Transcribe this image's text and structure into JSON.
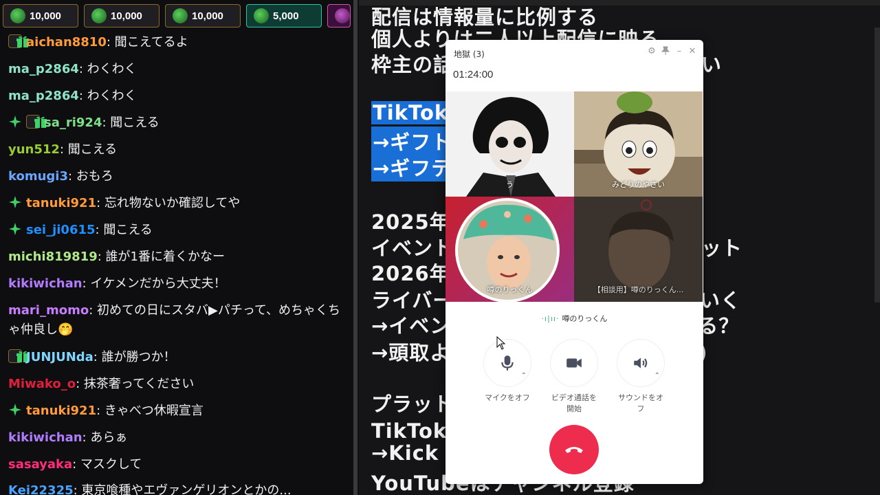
{
  "gifts": [
    {
      "amount": "10,000"
    },
    {
      "amount": "10,000"
    },
    {
      "amount": "10,000"
    },
    {
      "amount": "5,000"
    },
    {
      "amount": ""
    }
  ],
  "chat": [
    {
      "user": "aichan8810",
      "text": ": 聞こえてるよ",
      "color": "#ff9b3b",
      "badges": [
        "gift"
      ]
    },
    {
      "user": "ma_p2864",
      "text": ": わくわく",
      "color": "#8ee3c6",
      "badges": []
    },
    {
      "user": "ma_p2864",
      "text": ": わくわく",
      "color": "#8ee3c6",
      "badges": []
    },
    {
      "user": "sa_ri924",
      "text": ": 聞こえる",
      "color": "#7fe08a",
      "badges": [
        "sparkle",
        "gift"
      ]
    },
    {
      "user": "yun512",
      "text": ": 聞こえる",
      "color": "#9acd32",
      "badges": []
    },
    {
      "user": "komugi3",
      "text": ": おもろ",
      "color": "#6aa6ff",
      "badges": []
    },
    {
      "user": "tanuki921",
      "text": ": 忘れ物ないか確認してや",
      "color": "#ff9b3b",
      "badges": [
        "sparkle"
      ]
    },
    {
      "user": "sei_ji0615",
      "text": ": 聞こえる",
      "color": "#1e90ff",
      "badges": [
        "sparkle"
      ]
    },
    {
      "user": "michi819819",
      "text": ": 誰が1番に着くかなー",
      "color": "#b0e98a",
      "badges": []
    },
    {
      "user": "kikiwichan",
      "text": ": イケメンだから大丈夫！",
      "color": "#b27cff",
      "badges": []
    },
    {
      "user": "mari_momo",
      "text": ": 初めての日にスタバ▶パチって、めちゃくちゃ仲良し🤭",
      "color": "#c77dff",
      "badges": []
    },
    {
      "user": "JUNJUNda",
      "text": ": 誰が勝つか！",
      "color": "#7fd6ff",
      "badges": [
        "gift"
      ]
    },
    {
      "user": "Miwako_o",
      "text": ": 抹茶奢ってください",
      "color": "#e0203a",
      "badges": []
    },
    {
      "user": "tanuki921",
      "text": ": きゃべつ休暇宣言",
      "color": "#ff9b3b",
      "badges": [
        "sparkle"
      ]
    },
    {
      "user": "kikiwichan",
      "text": ": あらぁ",
      "color": "#b27cff",
      "badges": []
    },
    {
      "user": "sasayaka",
      "text": ": マスクして",
      "color": "#ff2d7a",
      "badges": []
    },
    {
      "user": "Kei22325",
      "text": ": 東京喰種やエヴァンゲリオンとかの...",
      "color": "#4aa3ff",
      "badges": []
    }
  ],
  "slide": {
    "lines": [
      {
        "text": "配信は情報量に比例する",
        "highlight": false
      },
      {
        "text": "個人よりは二人以上配信に映る",
        "highlight": false
      },
      {
        "text": "枠主の話　　　　　　　　　うがいい",
        "highlight": false
      },
      {
        "text": "TikTok",
        "highlight": true
      },
      {
        "text": "→ギフト　　　　　　　　　？",
        "highlight": true
      },
      {
        "text": "→ギフテ　　　　　　　　　がる",
        "highlight": true
      },
      {
        "text": "2025年",
        "highlight": false
      },
      {
        "text": "イベント　　　　　　　　　イブリット",
        "highlight": false
      },
      {
        "text": "2026年",
        "highlight": false
      },
      {
        "text": "ライバー　　　　　　　　　わっていく",
        "highlight": false
      },
      {
        "text": "→イベン　　　　　　　　　り上がる？",
        "highlight": false
      },
      {
        "text": "→頭取よ　　　　　　　　　り貧？)",
        "highlight": false
      },
      {
        "text": "プラット",
        "highlight": false
      },
      {
        "text": "TikTok　　　　　　　　　　限",
        "highlight": false
      },
      {
        "text": "→Kick",
        "highlight": false
      },
      {
        "text": "YouTubeはチャンネル登録",
        "highlight": false
      }
    ]
  },
  "call": {
    "title": "地獄 (3)",
    "timer": "01:24:00",
    "participants": [
      {
        "name": "う"
      },
      {
        "name": "みどりのやさい"
      },
      {
        "name": "噂のりっくん"
      },
      {
        "name": "【相談用】噂のりっくん..."
      }
    ],
    "speaking": "噂のりっくん",
    "controls": {
      "mic": "マイクをオフ",
      "video": "ビデオ通話を開始",
      "sound": "サウンドをオフ"
    }
  }
}
